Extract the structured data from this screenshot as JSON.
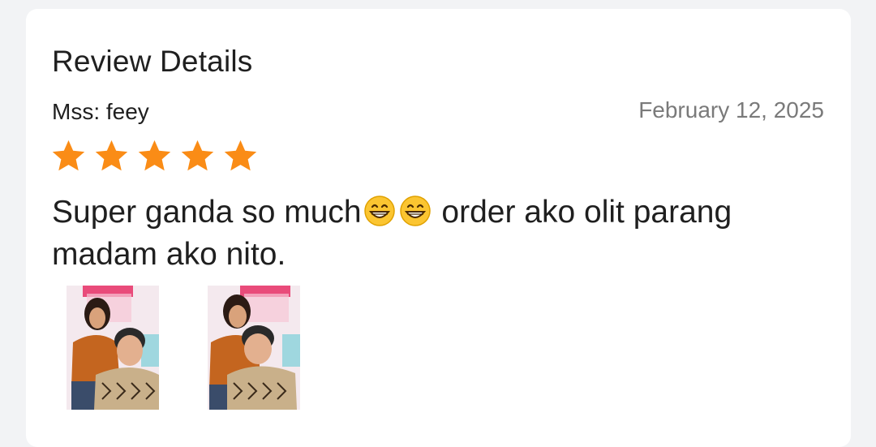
{
  "header": {
    "title": "Review Details"
  },
  "review": {
    "reviewer": "Mss: feey",
    "date": "February 12, 2025",
    "rating": 5,
    "text_part1": "Super ganda so much",
    "text_part2": " order ako olit parang madam ako nito.",
    "emojis": [
      "grinning-face-icon",
      "grinning-face-icon"
    ],
    "photo_count": 2,
    "star_color": "#fa8c16"
  }
}
